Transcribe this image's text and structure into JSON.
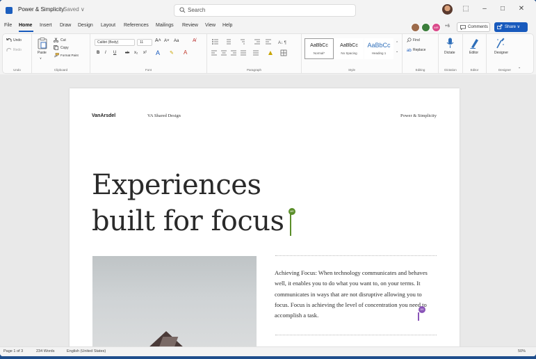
{
  "titlebar": {
    "doc_title": "Power & Simplicity",
    "saved_status": "Saved ∨",
    "search_placeholder": "Search",
    "window_controls": {
      "collapse": "⬚",
      "minimize": "–",
      "maximize": "□",
      "close": "✕"
    }
  },
  "tabs": [
    "File",
    "Home",
    "Insert",
    "Draw",
    "Design",
    "Layout",
    "References",
    "Mailings",
    "Review",
    "View",
    "Help"
  ],
  "active_tab": "Home",
  "collab": {
    "initials": "MR",
    "count": "+6",
    "colors": [
      "#9c6a4a",
      "#3b7d3b",
      "#d94a8a"
    ]
  },
  "buttons": {
    "comments": "Comments",
    "share": "Share ∨"
  },
  "ribbon": {
    "undo": {
      "undo": "Undo",
      "redo": "Redo",
      "label": "Undo"
    },
    "clipboard": {
      "paste": "Paste",
      "cut": "Cut",
      "copy": "Copy",
      "format_painter": "Format Paint",
      "label": "Clipboard"
    },
    "font": {
      "family": "Calibri (Body)",
      "size": "11",
      "bold": "B",
      "italic": "I",
      "underline": "U",
      "strike": "ab",
      "subscript": "x₂",
      "superscript": "x²",
      "grow": "A˄",
      "shrink": "A˅",
      "case": "Aa",
      "clear": "A̸",
      "font_color": "A",
      "highlight": "✎",
      "label": "Font"
    },
    "paragraph": {
      "label": "Paragraph"
    },
    "styles": {
      "items": [
        {
          "preview": "AaBbCc",
          "name": "Normal*"
        },
        {
          "preview": "AaBbCc",
          "name": "No Spacing"
        },
        {
          "preview": "AaBbCc",
          "name": "Heading 1"
        }
      ],
      "label": "Style"
    },
    "editing": {
      "find": "Find",
      "replace": "Replace",
      "label": "Editing"
    },
    "dictation": {
      "dictate": "Dictate",
      "label": "Dictation"
    },
    "editor": {
      "editor": "Editor",
      "label": "Editor"
    },
    "designer": {
      "designer": "Designer",
      "label": "Designer"
    }
  },
  "document": {
    "header_logo": "VanArsdel",
    "header_mid": "VA Shared Design",
    "header_right": "Power & Simplicity",
    "headline_line1": "Experiences",
    "headline_line2": "built for focus",
    "cursor1_initials": "MR",
    "cursor2_initials": "DS",
    "body": "Achieving Focus: When technology communicates and behaves well, it enables you to do what you want to, on your terms. It communicates in ways that are not disruptive allowing you to focus. Focus is achieving the level of concentration you need to accomplish a task."
  },
  "statusbar": {
    "page": "Page 1 of 3",
    "words": "234 Words",
    "language": "English (United States)",
    "zoom": "50%"
  },
  "colors": {
    "accent": "#185abd",
    "cursor1": "#5b8e2a",
    "cursor2": "#8a55b8"
  }
}
